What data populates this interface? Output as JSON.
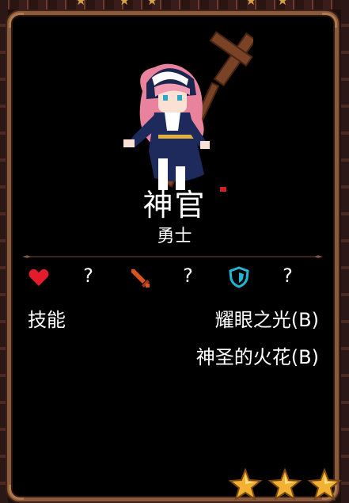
{
  "hero": {
    "name": "神官",
    "class": "勇士"
  },
  "stats": {
    "health": "?",
    "attack": "?",
    "defense": "?"
  },
  "skills": {
    "label": "技能",
    "list": [
      "耀眼之光(B)",
      "神圣的火花(B)"
    ]
  },
  "rarity": {
    "stars": 3
  },
  "colors": {
    "frame": "#8a5a3c",
    "heart": "#e21c2c",
    "sword": "#d9531e",
    "shield": "#1fb7d4",
    "star": "#f2b133"
  },
  "icons": [
    "heart-icon",
    "sword-icon",
    "shield-icon",
    "star-icon"
  ]
}
